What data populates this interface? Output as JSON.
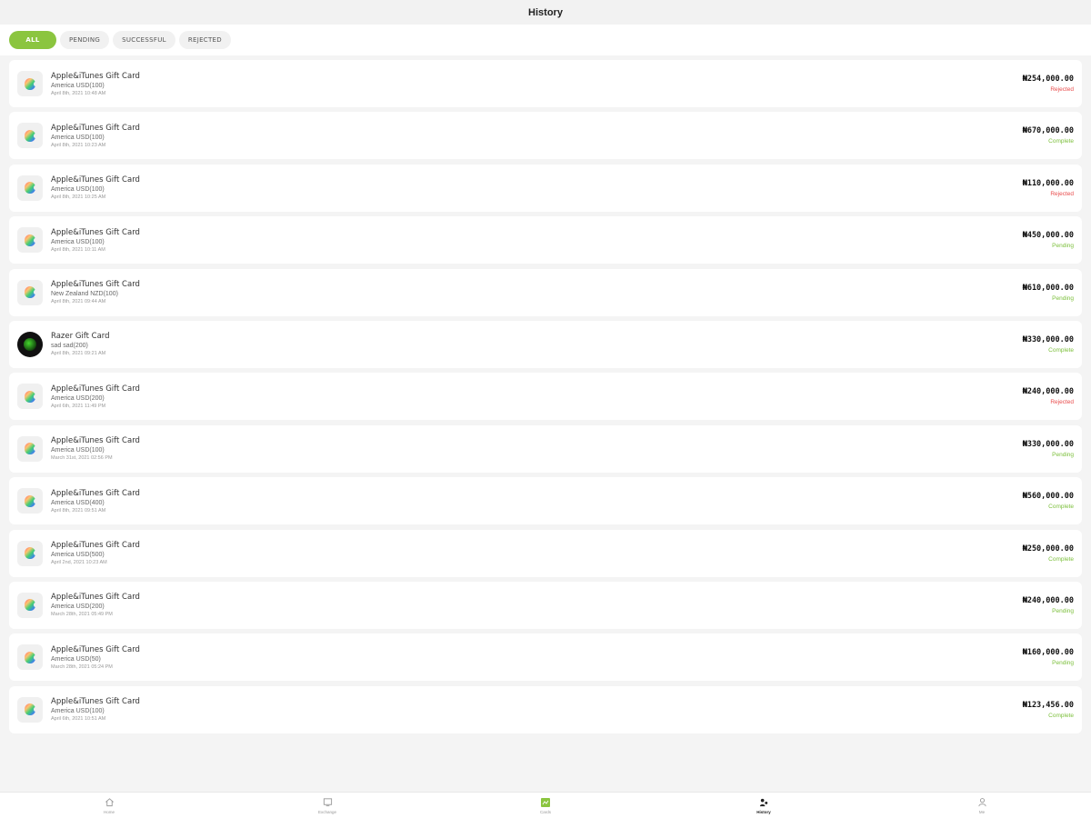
{
  "header": {
    "title": "History"
  },
  "filters": [
    {
      "label": "ALL",
      "active": true
    },
    {
      "label": "PENDING",
      "active": false
    },
    {
      "label": "SUCCESSFUL",
      "active": false
    },
    {
      "label": "REJECTED",
      "active": false
    }
  ],
  "transactions": [
    {
      "name": "Apple&iTunes Gift Card",
      "sub": "America USD(100)",
      "date": "April 8th, 2021 10:48 AM",
      "amount": "₦254,000.00",
      "status": "Rejected",
      "icon": "apple-icon"
    },
    {
      "name": "Apple&iTunes Gift Card",
      "sub": "America USD(100)",
      "date": "April 8th, 2021 10:23 AM",
      "amount": "₦670,000.00",
      "status": "Complete",
      "icon": "apple-icon"
    },
    {
      "name": "Apple&iTunes Gift Card",
      "sub": "America USD(100)",
      "date": "April 8th, 2021 10:25 AM",
      "amount": "₦110,000.00",
      "status": "Rejected",
      "icon": "apple-icon"
    },
    {
      "name": "Apple&iTunes Gift Card",
      "sub": "America USD(100)",
      "date": "April 8th, 2021 10:11 AM",
      "amount": "₦450,000.00",
      "status": "Pending",
      "icon": "apple-icon"
    },
    {
      "name": "Apple&iTunes Gift Card",
      "sub": "New Zealand NZD(100)",
      "date": "April 8th, 2021 09:44 AM",
      "amount": "₦610,000.00",
      "status": "Pending",
      "icon": "apple-icon"
    },
    {
      "name": "Razer Gift Card",
      "sub": "sad sad(200)",
      "date": "April 8th, 2021 09:21 AM",
      "amount": "₦330,000.00",
      "status": "Complete",
      "icon": "razer-icon"
    },
    {
      "name": "Apple&iTunes Gift Card",
      "sub": "America USD(200)",
      "date": "April 6th, 2021 11:49 PM",
      "amount": "₦240,000.00",
      "status": "Rejected",
      "icon": "apple-icon"
    },
    {
      "name": "Apple&iTunes Gift Card",
      "sub": "America USD(100)",
      "date": "March 31st, 2021 02:56 PM",
      "amount": "₦330,000.00",
      "status": "Pending",
      "icon": "apple-icon"
    },
    {
      "name": "Apple&iTunes Gift Card",
      "sub": "America USD(400)",
      "date": "April 8th, 2021 09:51 AM",
      "amount": "₦560,000.00",
      "status": "Complete",
      "icon": "apple-icon"
    },
    {
      "name": "Apple&iTunes Gift Card",
      "sub": "America USD(500)",
      "date": "April 2nd, 2021 10:23 AM",
      "amount": "₦250,000.00",
      "status": "Complete",
      "icon": "apple-icon"
    },
    {
      "name": "Apple&iTunes Gift Card",
      "sub": "America USD(200)",
      "date": "March 28th, 2021 05:49 PM",
      "amount": "₦240,000.00",
      "status": "Pending",
      "icon": "apple-icon"
    },
    {
      "name": "Apple&iTunes Gift Card",
      "sub": "America USD(50)",
      "date": "March 28th, 2021 05:24 PM",
      "amount": "₦160,000.00",
      "status": "Pending",
      "icon": "apple-icon"
    },
    {
      "name": "Apple&iTunes Gift Card",
      "sub": "America USD(100)",
      "date": "April 6th, 2021 10:51 AM",
      "amount": "₦123,456.00",
      "status": "Complete",
      "icon": "apple-icon"
    }
  ],
  "tabs": [
    {
      "label": "Home",
      "icon": "home-icon",
      "active": false
    },
    {
      "label": "Exchange",
      "icon": "exchange-icon",
      "active": false
    },
    {
      "label": "Cards",
      "icon": "cards-icon",
      "active": false
    },
    {
      "label": "History",
      "icon": "history-icon",
      "active": true
    },
    {
      "label": "Me",
      "icon": "profile-icon",
      "active": false
    }
  ],
  "colors": {
    "accent": "#8bc53f",
    "rejected": "#e84c4c",
    "complete": "#7bbf3a"
  }
}
